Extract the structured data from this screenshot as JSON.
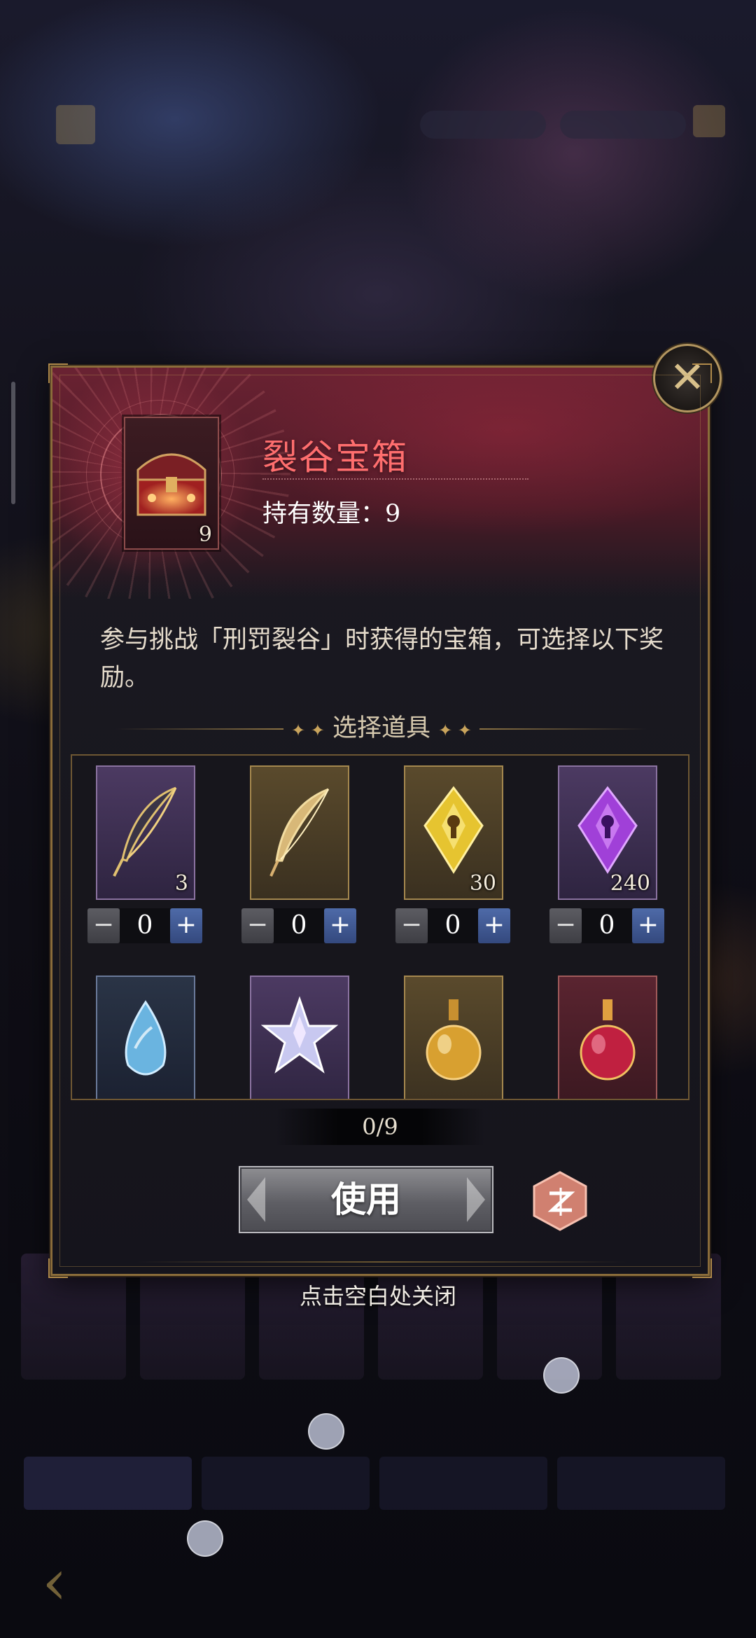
{
  "modal": {
    "title": "裂谷宝箱",
    "quantity_text": "持有数量：9",
    "chest_count": "9",
    "description": "参与挑战「刑罚裂谷」时获得的宝箱，可选择以下奖励。",
    "section_title": "选择道具",
    "items": [
      {
        "icon": "feather-dark-icon",
        "count": "3",
        "quantity": "0",
        "rarity": "purple"
      },
      {
        "icon": "feather-gold-icon",
        "count": "",
        "quantity": "0",
        "rarity": "gold"
      },
      {
        "icon": "crystal-gold-icon",
        "count": "30",
        "quantity": "0",
        "rarity": "gold"
      },
      {
        "icon": "crystal-purple-icon",
        "count": "240",
        "quantity": "0",
        "rarity": "purple"
      },
      {
        "icon": "drop-gem-icon",
        "count": "",
        "rarity": "blue"
      },
      {
        "icon": "star-crystal-icon",
        "count": "",
        "rarity": "purple"
      },
      {
        "icon": "potion-gold-icon",
        "count": "",
        "rarity": "gold"
      },
      {
        "icon": "potion-red-icon",
        "count": "",
        "rarity": "red"
      }
    ],
    "selection_counter": "0/9",
    "use_label": "使用",
    "close_hint": "点击空白处关闭",
    "minus": "−",
    "plus": "+"
  },
  "colors": {
    "title": "#ff6e6e",
    "accent_gold": "#b39660",
    "plus_button": "#4e6aa8"
  }
}
